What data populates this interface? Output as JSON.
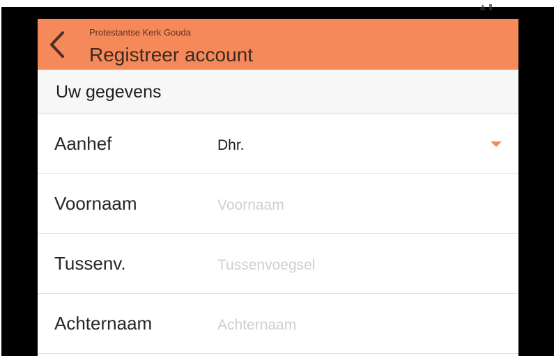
{
  "app_bar": {
    "subtitle": "Protestantse Kerk Gouda",
    "title": "Registreer account",
    "back_icon": "chevron-left-icon",
    "color": "#f6895a"
  },
  "section": {
    "title": "Uw gegevens"
  },
  "form": {
    "aanhef": {
      "label": "Aanhef",
      "value": "Dhr.",
      "dropdown_icon": "caret-down-icon"
    },
    "voornaam": {
      "label": "Voornaam",
      "placeholder": "Voornaam",
      "value": ""
    },
    "tussenvoegsel": {
      "label": "Tussenv.",
      "placeholder": "Tussenvoegsel",
      "value": ""
    },
    "achternaam": {
      "label": "Achternaam",
      "placeholder": "Achternaam",
      "value": ""
    }
  }
}
